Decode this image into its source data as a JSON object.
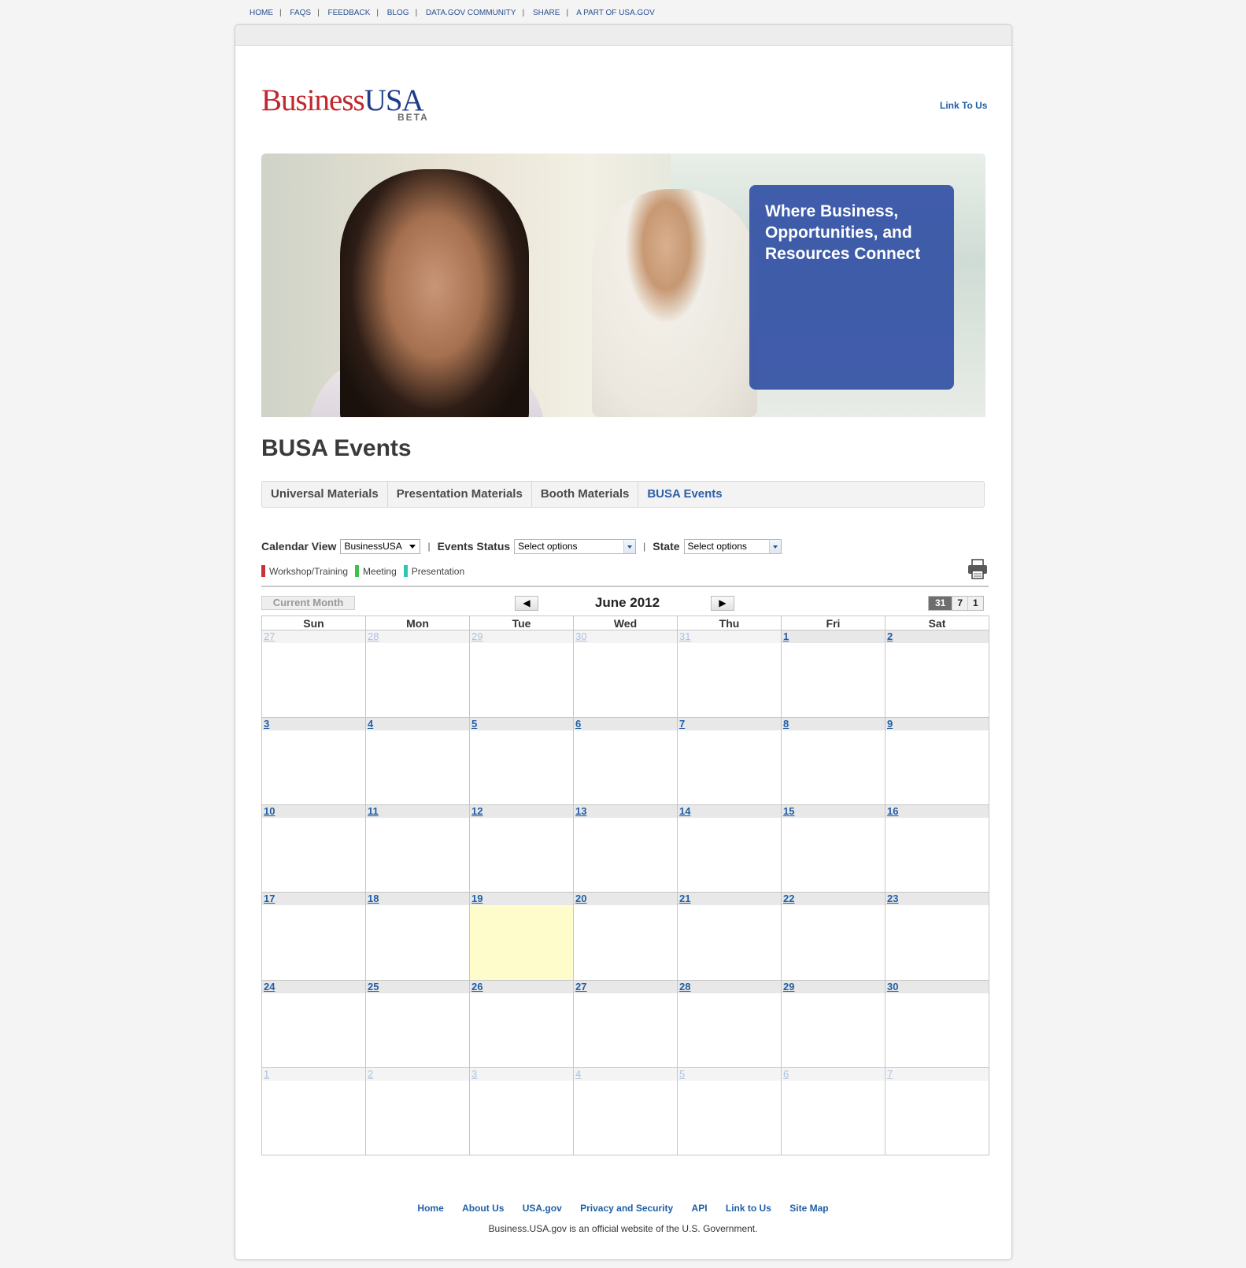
{
  "topnav": [
    "HOME",
    "FAQS",
    "FEEDBACK",
    "BLOG",
    "DATA.GOV COMMUNITY",
    "SHARE",
    "A PART OF USA.GOV"
  ],
  "logo": {
    "business": "Business",
    "usa": "USA",
    "beta": "BETA"
  },
  "header_link": "Link To Us",
  "hero": {
    "tagline": "Where Business, Opportunities, and Resources Connect"
  },
  "page_title": "BUSA Events",
  "tabs": [
    "Universal Materials",
    "Presentation Materials",
    "Booth Materials",
    "BUSA Events"
  ],
  "active_tab": "BUSA Events",
  "filters": {
    "calendar_view_label": "Calendar View",
    "calendar_view_value": "BusinessUSA",
    "events_status_label": "Events Status",
    "events_status_value": "Select options",
    "state_label": "State",
    "state_value": "Select options"
  },
  "legend": [
    {
      "label": "Workshop/Training",
      "color": "#c8323c"
    },
    {
      "label": "Meeting",
      "color": "#3ec24a"
    },
    {
      "label": "Presentation",
      "color": "#2cc6b3"
    }
  ],
  "calendar": {
    "current_month_button": "Current Month",
    "prev_icon": "◀",
    "next_icon": "▶",
    "month_title": "June 2012",
    "view_switch": [
      "31",
      "7",
      "1"
    ],
    "weekdays": [
      "Sun",
      "Mon",
      "Tue",
      "Wed",
      "Thu",
      "Fri",
      "Sat"
    ],
    "weeks": [
      [
        "27",
        "28",
        "29",
        "30",
        "31",
        "1",
        "2"
      ],
      [
        "3",
        "4",
        "5",
        "6",
        "7",
        "8",
        "9"
      ],
      [
        "10",
        "11",
        "12",
        "13",
        "14",
        "15",
        "16"
      ],
      [
        "17",
        "18",
        "19",
        "20",
        "21",
        "22",
        "23"
      ],
      [
        "24",
        "25",
        "26",
        "27",
        "28",
        "29",
        "30"
      ],
      [
        "1",
        "2",
        "3",
        "4",
        "5",
        "6",
        "7"
      ]
    ],
    "today": "19",
    "today_color": "#fffccc"
  },
  "footer": {
    "links": [
      "Home",
      "About Us",
      "USA.gov",
      "Privacy and Security",
      "API",
      "Link to Us",
      "Site Map"
    ],
    "note": "Business.USA.gov is an official website of the U.S. Government."
  }
}
